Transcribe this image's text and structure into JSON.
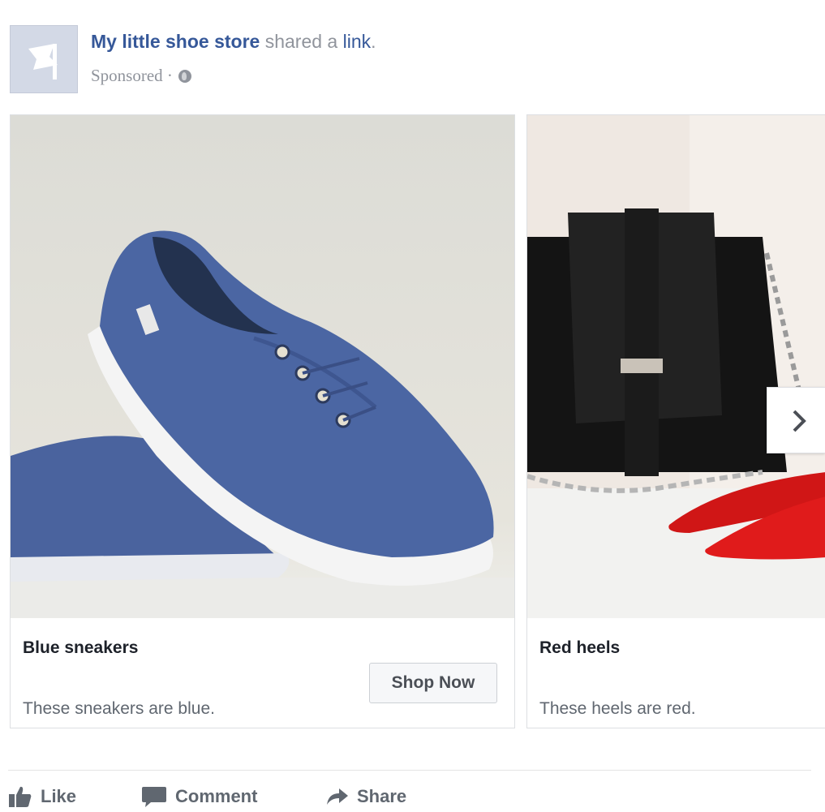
{
  "post": {
    "page_name": "My little shoe store",
    "shared_text": "shared a",
    "link_text": "link",
    "period": ".",
    "sponsored": "Sponsored",
    "separator": "·",
    "avatar_icon": "flag-icon"
  },
  "carousel": {
    "cards": [
      {
        "title": "Blue sneakers",
        "description": "These sneakers are blue.",
        "cta": "Shop Now",
        "image": "blue-sneakers-photo"
      },
      {
        "title": "Red heels",
        "description": "These heels are red.",
        "image": "black-bag-red-heels-photo"
      }
    ],
    "next_icon": "chevron-right-icon"
  },
  "actions": {
    "like": "Like",
    "comment": "Comment",
    "share": "Share"
  },
  "colors": {
    "link_blue": "#365899",
    "meta_gray": "#90949c",
    "action_gray": "#606770"
  }
}
